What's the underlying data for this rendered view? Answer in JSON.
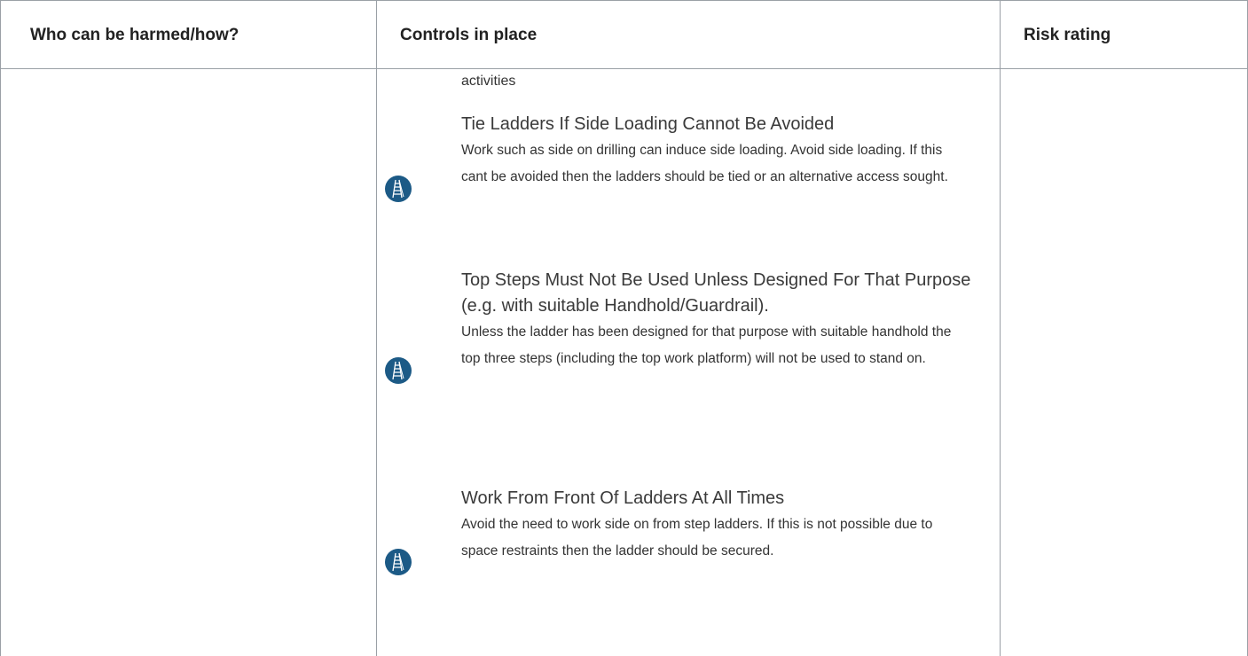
{
  "table": {
    "headers": {
      "who": "Who can be harmed/how?",
      "controls": "Controls in place",
      "risk": "Risk rating"
    },
    "continued_text": "activities",
    "controls": [
      {
        "icon": "ladder-icon",
        "title": "Tie Ladders If Side Loading Cannot Be Avoided",
        "description": "Work such as side on drilling can induce side loading. Avoid side loading. If this cant be avoided then the ladders should be tied or an alternative access sought."
      },
      {
        "icon": "ladder-icon",
        "title": "Top Steps Must Not Be Used Unless Designed For That Purpose (e.g. with suitable Handhold/Guardrail).",
        "description": "Unless the ladder has been designed for that purpose with suitable handhold the top three steps (including the top work platform) will not be used to stand on."
      },
      {
        "icon": "ladder-icon",
        "title": "Work From Front Of Ladders At All Times",
        "description": "Avoid the need to work side on from step ladders. If this is not possible due to space restraints then the ladder should be secured."
      }
    ],
    "colors": {
      "icon_background": "#1c5a86",
      "border": "#9aa0a6"
    }
  }
}
